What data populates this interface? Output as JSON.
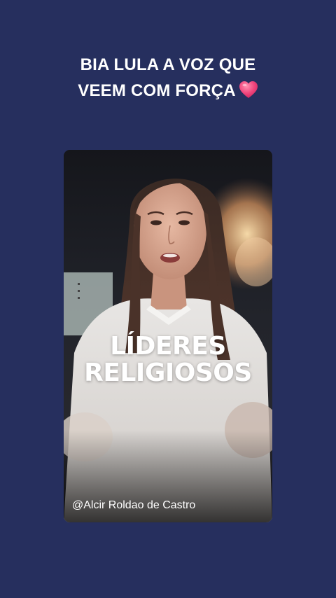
{
  "story": {
    "headline_line1": "BIA LULA A VOZ QUE",
    "headline_line2": "VEEM COM FORÇA",
    "headline_emoji": "heart-icon"
  },
  "video": {
    "overlay_line1": "LÍDERES",
    "overlay_line2": "RELIGIOSOS",
    "credit": "@Alcir Roldao de Castro"
  },
  "colors": {
    "background": "#262f5e",
    "heart": "#f0467d",
    "text": "#ffffff"
  }
}
